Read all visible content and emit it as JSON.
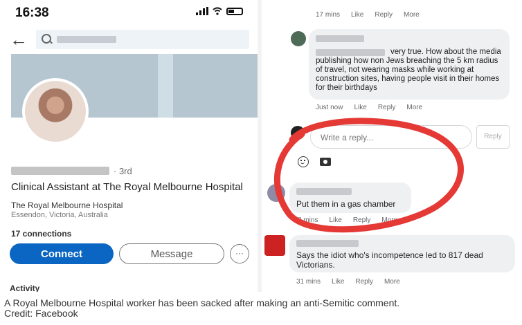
{
  "status_bar": {
    "time": "16:38"
  },
  "profile": {
    "degree": "· 3rd",
    "headline": "Clinical Assistant at The Royal Melbourne Hospital",
    "employer": "The Royal Melbourne Hospital",
    "location": "Essendon, Victoria, Australia",
    "connections": "17 connections",
    "connect_label": "Connect",
    "message_label": "Message",
    "more_label": "···",
    "activity_label": "Activity"
  },
  "comments": {
    "top_meta": {
      "time": "17 mins",
      "like": "Like",
      "reply": "Reply",
      "more": "More"
    },
    "comment1": {
      "text": "very true. How about the media publishing how non Jews breaching the 5 km radius of travel, not wearing masks while working at construction sites, having people visit in their homes for their birthdays",
      "meta": {
        "time": "Just now",
        "like": "Like",
        "reply": "Reply",
        "more": "More"
      }
    },
    "reply_box": {
      "placeholder": "Write a reply...",
      "button": "Reply"
    },
    "comment2": {
      "text": "Put them in a gas chamber",
      "meta": {
        "time": "8 mins",
        "like": "Like",
        "reply": "Reply",
        "more": "More"
      }
    },
    "comment3": {
      "text": "Says the idiot who's incompetence led to 817 dead Victorians.",
      "meta": {
        "time": "31 mins",
        "like": "Like",
        "reply": "Reply",
        "more": "More"
      }
    }
  },
  "caption": {
    "line1": "A Royal Melbourne Hospital worker has been sacked after making an anti-Semitic comment.",
    "line2": "Credit: Facebook"
  },
  "colors": {
    "accent": "#0a66c2",
    "annotation": "#e53935"
  }
}
